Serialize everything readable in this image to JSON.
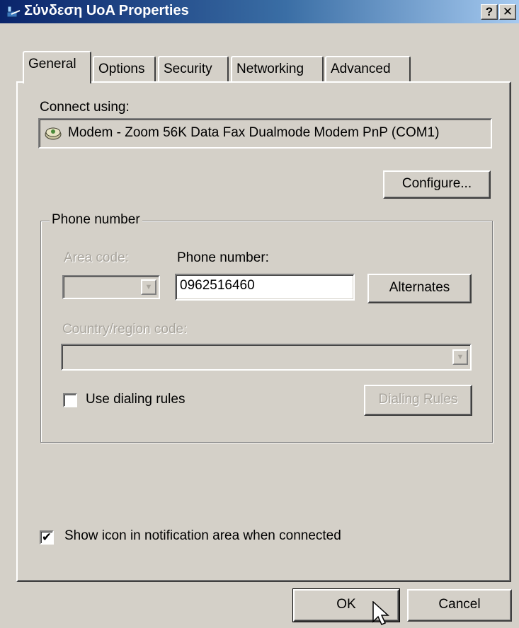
{
  "window": {
    "title": "Σύνδεση UoA Properties",
    "help_label": "?",
    "close_label": "✕"
  },
  "tabs": [
    {
      "label": "General",
      "active": true
    },
    {
      "label": "Options",
      "active": false
    },
    {
      "label": "Security",
      "active": false
    },
    {
      "label": "Networking",
      "active": false
    },
    {
      "label": "Advanced",
      "active": false
    }
  ],
  "general": {
    "connect_using_label": "Connect using:",
    "device_name": "Modem - Zoom 56K Data Fax Dualmode Modem PnP (COM1)",
    "device_icon": "modem-icon",
    "configure_label": "Configure...",
    "phone_group_label": "Phone number",
    "area_code_label": "Area code:",
    "area_code_value": "",
    "phone_number_label": "Phone number:",
    "phone_number_value": "0962516460",
    "alternates_label": "Alternates",
    "country_code_label": "Country/region code:",
    "country_code_value": "",
    "use_dialing_rules_label": "Use dialing rules",
    "use_dialing_rules_checked": false,
    "dialing_rules_label": "Dialing Rules",
    "show_icon_label": "Show icon in notification area when connected",
    "show_icon_checked": true,
    "check_mark": "✔"
  },
  "footer": {
    "ok_label": "OK",
    "cancel_label": "Cancel"
  },
  "colors": {
    "titlebar_start": "#0a246a",
    "titlebar_end": "#a6caf0",
    "face": "#d4d0c8"
  }
}
